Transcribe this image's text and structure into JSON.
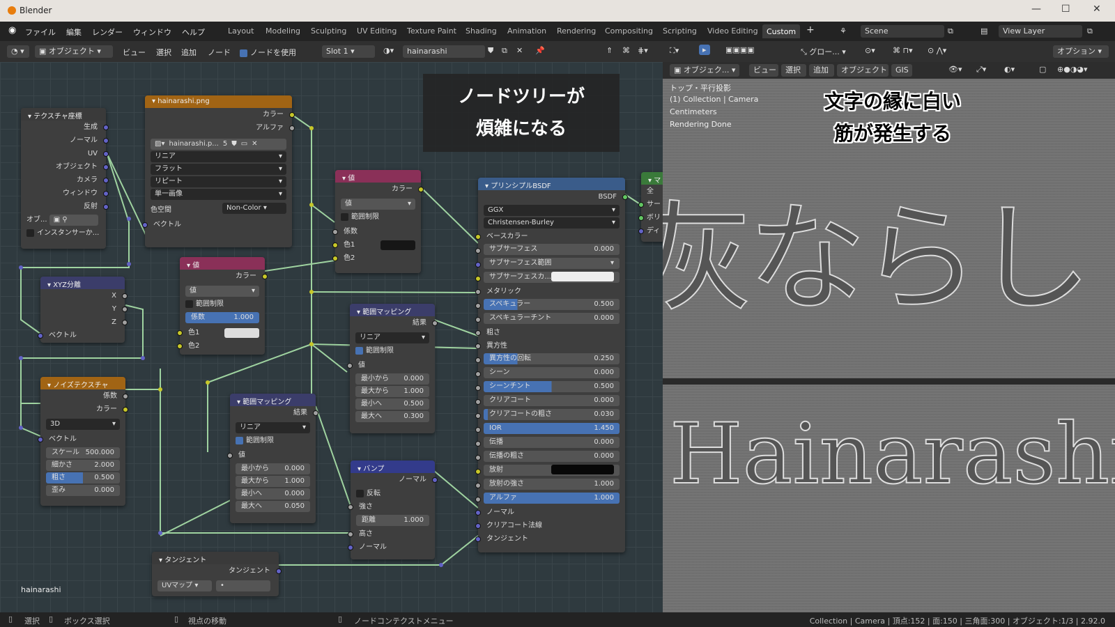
{
  "app": {
    "title": "Blender"
  },
  "menu": [
    "ファイル",
    "編集",
    "レンダー",
    "ウィンドウ",
    "ヘルプ"
  ],
  "workspaces": [
    "Layout",
    "Modeling",
    "Sculpting",
    "UV Editing",
    "Texture Paint",
    "Shading",
    "Animation",
    "Rendering",
    "Compositing",
    "Scripting",
    "Video Editing",
    "Custom"
  ],
  "active_workspace": "Custom",
  "scene": "Scene",
  "view_layer": "View Layer",
  "node_header": {
    "mode": "オブジェクト",
    "view": "ビュー",
    "select": "選択",
    "add": "追加",
    "node": "ノード",
    "use_nodes": "ノードを使用",
    "slot": "Slot 1",
    "material": "hainarashi"
  },
  "vp_header": {
    "global": "グロー...",
    "options": "オプション",
    "mode": "オブジェク...",
    "view": "ビュー",
    "select": "選択",
    "add": "追加",
    "object": "オブジェクト",
    "gis": "GIS"
  },
  "vp_info": [
    "トップ・平行投影",
    "(1) Collection | Camera",
    "Centimeters",
    "Rendering Done"
  ],
  "material_name": "hainarashi",
  "overlay1": [
    "ノードツリーが",
    "煩雑になる"
  ],
  "overlay2": [
    "文字の縁に白い",
    "筋が発生する"
  ],
  "vp_art": {
    "jp": "灰ならし",
    "en": "Hainarashi"
  },
  "nodes": {
    "texcoord": {
      "title": "テクスチャ座標",
      "outs": [
        "生成",
        "ノーマル",
        "UV",
        "オブジェクト",
        "カメラ",
        "ウィンドウ",
        "反射"
      ],
      "obj": "オブ...",
      "inst": "インスタンサーか..."
    },
    "image": {
      "title": "hainarashi.png",
      "outs": [
        "カラー",
        "アルファ"
      ],
      "file": "hainarashi.p...",
      "users": "5",
      "interp": "リニア",
      "proj": "フラット",
      "ext": "リピート",
      "src": "単一画像",
      "cs_label": "色空間",
      "cs": "Non-Color",
      "vec": "ベクトル"
    },
    "sep": {
      "title": "XYZ分離",
      "outs": [
        "X",
        "Y",
        "Z"
      ],
      "vec": "ベクトル"
    },
    "val1": {
      "title": "値",
      "out": "カラー",
      "type": "値",
      "clamp": "範囲制限",
      "fac": "係数",
      "fac_v": "1.000",
      "c1": "色1",
      "c2": "色2"
    },
    "val2": {
      "title": "値",
      "out": "カラー",
      "type": "値",
      "clamp": "範囲制限",
      "fac": "係数",
      "c1": "色1",
      "c2": "色2"
    },
    "noise": {
      "title": "ノイズテクスチャ",
      "outs": [
        "係数",
        "カラー"
      ],
      "dim": "3D",
      "vec": "ベクトル",
      "fields": [
        [
          "スケール",
          "500.000"
        ],
        [
          "細かさ",
          "2.000"
        ],
        [
          "粗さ",
          "0.500"
        ],
        [
          "歪み",
          "0.000"
        ]
      ]
    },
    "map1": {
      "title": "範囲マッピング",
      "out": "結果",
      "interp": "リニア",
      "clamp": "範囲制限",
      "val": "値",
      "fields": [
        [
          "最小から",
          "0.000"
        ],
        [
          "最大から",
          "1.000"
        ],
        [
          "最小へ",
          "0.000"
        ],
        [
          "最大へ",
          "0.050"
        ]
      ]
    },
    "map2": {
      "title": "範囲マッピング",
      "out": "結果",
      "interp": "リニア",
      "clamp": "範囲制限",
      "val": "値",
      "fields": [
        [
          "最小から",
          "0.000"
        ],
        [
          "最大から",
          "1.000"
        ],
        [
          "最小へ",
          "0.500"
        ],
        [
          "最大へ",
          "0.300"
        ]
      ]
    },
    "bump": {
      "title": "バンプ",
      "out": "ノーマル",
      "inv": "反転",
      "str": "強さ",
      "dist": "距離",
      "dist_v": "1.000",
      "h": "高さ",
      "n": "ノーマル"
    },
    "tangent": {
      "title": "タンジェント",
      "out": "タンジェント",
      "uv": "UVマップ",
      "field": "•"
    },
    "bsdf": {
      "title": "プリンシプルBSDF",
      "out": "BSDF",
      "dist": "GGX",
      "ss": "Christensen-Burley",
      "rows": [
        [
          "ベースカラー",
          ""
        ],
        [
          "サブサーフェス",
          "0.000"
        ],
        [
          "サブサーフェス範囲",
          ""
        ],
        [
          "サブサーフェスカ...",
          ""
        ],
        [
          "メタリック",
          ""
        ],
        [
          "スペキュラー",
          "0.500"
        ],
        [
          "スペキュラーチント",
          "0.000"
        ],
        [
          "粗さ",
          ""
        ],
        [
          "異方性",
          ""
        ],
        [
          "異方性の回転",
          "0.250"
        ],
        [
          "シーン",
          "0.000"
        ],
        [
          "シーンチント",
          "0.500"
        ],
        [
          "クリアコート",
          "0.000"
        ],
        [
          "クリアコートの粗さ",
          "0.030"
        ],
        [
          "IOR",
          "1.450"
        ],
        [
          "伝播",
          "0.000"
        ],
        [
          "伝播の粗さ",
          "0.000"
        ],
        [
          "放射",
          ""
        ],
        [
          "放射の強さ",
          "1.000"
        ],
        [
          "アルファ",
          "1.000"
        ],
        [
          "ノーマル",
          ""
        ],
        [
          "クリアコート法線",
          ""
        ],
        [
          "タンジェント",
          ""
        ]
      ]
    },
    "output": {
      "title": "マ",
      "rows": [
        "全",
        "サー",
        "ボリ",
        "ディ"
      ]
    }
  },
  "status": {
    "select": "選択",
    "box": "ボックス選択",
    "move": "視点の移動",
    "ctx": "ノードコンテクストメニュー",
    "info": "Collection | Camera | 頂点:152 | 面:150 | 三角面:300 | オブジェクト:1/3 | 2.92.0"
  },
  "colors": {
    "accent": "#4772b3",
    "image_header": "#a16414",
    "bsdf_header": "#3a5c8a"
  }
}
